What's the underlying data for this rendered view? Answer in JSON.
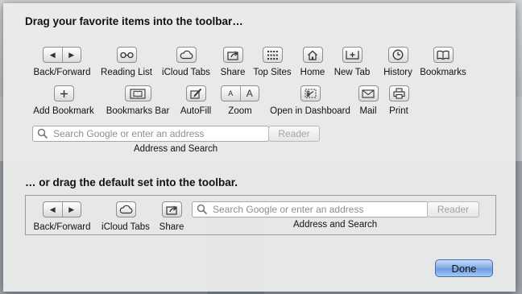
{
  "headings": {
    "favorites": "Drag your favorite items into the toolbar…",
    "default_set": "… or drag the default set into the toolbar."
  },
  "items": {
    "back_forward": "Back/Forward",
    "reading_list": "Reading List",
    "icloud_tabs": "iCloud Tabs",
    "share": "Share",
    "top_sites": "Top Sites",
    "home": "Home",
    "new_tab": "New Tab",
    "history": "History",
    "bookmarks": "Bookmarks",
    "add_bookmark": "Add Bookmark",
    "bookmarks_bar": "Bookmarks Bar",
    "autofill": "AutoFill",
    "zoom": "Zoom",
    "open_in_dashboard": "Open in Dashboard",
    "mail": "Mail",
    "print": "Print"
  },
  "search": {
    "placeholder": "Search Google or enter an address",
    "reader_label": "Reader",
    "caption": "Address and Search"
  },
  "zoom_glyphs": {
    "small": "A",
    "large": "A"
  },
  "done_label": "Done",
  "icons": [
    "back-forward-icon",
    "reading-list-icon",
    "icloud-icon",
    "share-icon",
    "top-sites-icon",
    "home-icon",
    "new-tab-icon",
    "history-icon",
    "bookmarks-icon",
    "add-bookmark-icon",
    "bookmarks-bar-icon",
    "autofill-icon",
    "zoom-icon",
    "dashboard-icon",
    "mail-icon",
    "print-icon",
    "search-icon"
  ]
}
